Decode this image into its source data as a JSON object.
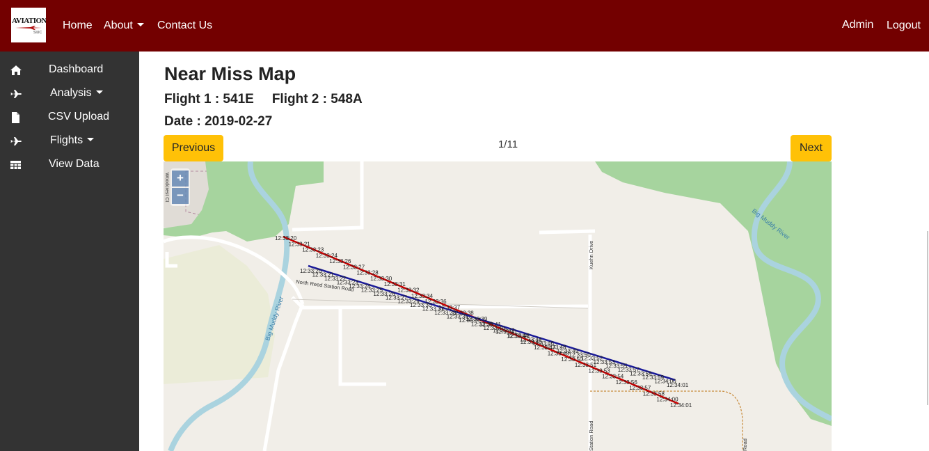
{
  "brand": {
    "logo_text": "AVIATION",
    "logo_sub": "SIUC"
  },
  "nav": {
    "home": "Home",
    "about": "About",
    "contact": "Contact Us",
    "admin": "Admin",
    "logout": "Logout"
  },
  "sidebar": {
    "items": [
      {
        "label": "Dashboard",
        "icon": "home-icon"
      },
      {
        "label": "Analysis",
        "icon": "plane-icon"
      },
      {
        "label": "CSV Upload",
        "icon": "file-icon"
      },
      {
        "label": "Flights",
        "icon": "plane-icon"
      },
      {
        "label": "View Data",
        "icon": "table-icon"
      }
    ]
  },
  "page": {
    "title": "Near Miss Map",
    "flight1": "Flight 1 : 541E",
    "flight2": "Flight 2 : 548A",
    "date": "Date : 2019-02-27"
  },
  "pager": {
    "previous": "Previous",
    "next": "Next",
    "position": "1/11"
  },
  "map": {
    "zoom_in": "+",
    "zoom_out": "−",
    "road_labels": [
      "North Reed Station Road",
      "Kuehn Drive",
      "Woodcrest Ct",
      "Station Road",
      "Road"
    ],
    "river_labels": [
      "Big Muddy River",
      "Big Muddy River"
    ],
    "flight1_color": "#cc0000",
    "flight2_color": "#1a1a99",
    "flight1_labels": [
      "12:33:20",
      "12:33:21",
      "12:33:23",
      "12:33:24",
      "12:33:26",
      "12:33:27",
      "12:33:28",
      "12:33:30",
      "12:33:31",
      "12:33:32",
      "12:33:34",
      "12:33:36",
      "12:33:37",
      "12:33:38",
      "12:33:39",
      "12:33:41",
      "12:33:42",
      "12:33:44",
      "12:33:45",
      "12:33:47",
      "12:33:48",
      "12:33:50",
      "12:33:51",
      "12:33:53",
      "12:33:54",
      "12:33:56",
      "12:33:57",
      "12:33:58",
      "12:34:00",
      "12:34:01"
    ],
    "flight2_labels": [
      "12:33:20",
      "12:33:21",
      "12:33:22",
      "12:33:23",
      "12:33:24",
      "12:33:25",
      "12:33:26",
      "12:33:27",
      "12:33:29",
      "12:33:30",
      "12:33:31",
      "12:33:33",
      "12:33:35",
      "12:33:37",
      "12:33:38",
      "12:33:40",
      "12:33:41",
      "12:33:43",
      "12:33:44",
      "12:33:46",
      "12:33:48",
      "12:33:49",
      "12:33:50",
      "12:33:52",
      "12:33:53",
      "12:33:55",
      "12:33:57",
      "12:33:58",
      "12:33:59",
      "12:34:00",
      "12:34:01"
    ]
  }
}
